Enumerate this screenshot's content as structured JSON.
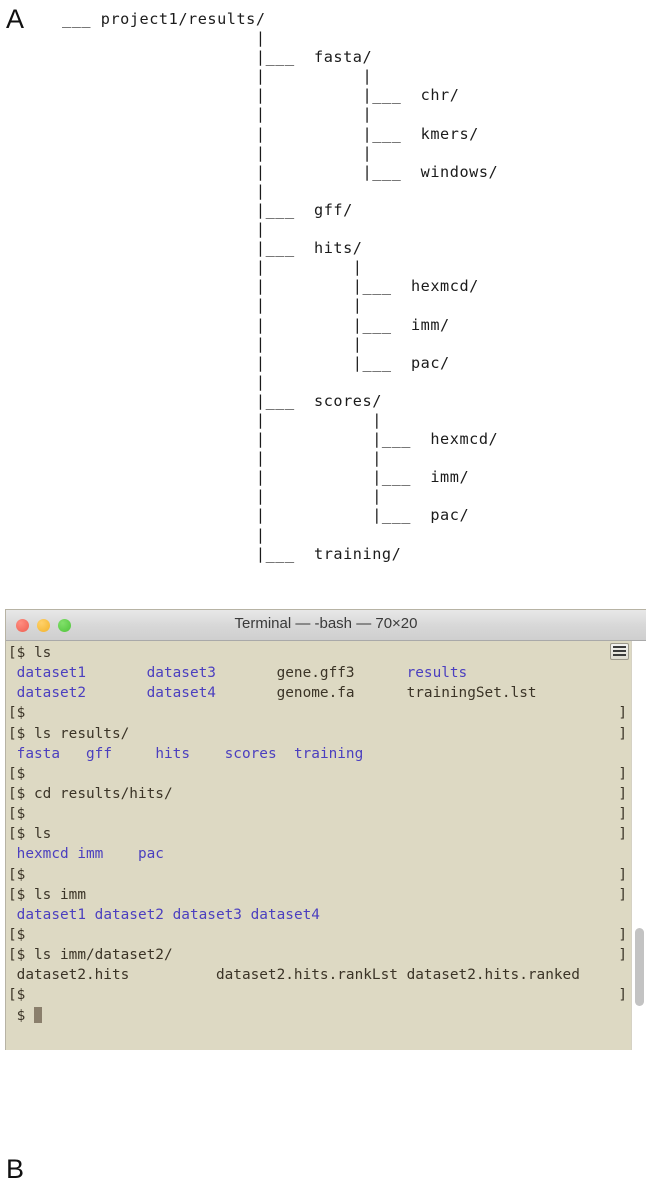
{
  "panels": {
    "a_label": "A",
    "b_label": "B"
  },
  "tree": {
    "root": "project1/results/",
    "ascii": "___ project1/results/\n                    |\n                    |___  fasta/\n                    |          |\n                    |          |___  chr/\n                    |          |\n                    |          |___  kmers/\n                    |          |\n                    |          |___  windows/\n                    |\n                    |___  gff/\n                    |\n                    |___  hits/\n                    |         |\n                    |         |___  hexmcd/\n                    |         |\n                    |         |___  imm/\n                    |         |\n                    |         |___  pac/\n                    |\n                    |___  scores/\n                    |           |\n                    |           |___  hexmcd/\n                    |           |\n                    |           |___  imm/\n                    |           |\n                    |           |___  pac/\n                    |\n                    |___  training/",
    "nodes": [
      "project1/results/",
      "fasta/",
      "chr/",
      "kmers/",
      "windows/",
      "gff/",
      "hits/",
      "hexmcd/",
      "imm/",
      "pac/",
      "scores/",
      "hexmcd/",
      "imm/",
      "pac/",
      "training/"
    ]
  },
  "terminal": {
    "title": "Terminal — -bash — 70×20",
    "prompt": "$",
    "prompt_left_bracket": "[",
    "prompt_right_bracket": "]",
    "colors": {
      "background": "#ddd9c3",
      "text": "#3b3427",
      "directory": "#4b3fbf",
      "cursor": "#8a7f6c",
      "titlebar": "#d8d8d8",
      "close_button": "#ee5f52",
      "minimize_button": "#f2b32b",
      "zoom_button": "#4fc43a"
    },
    "window_buttons": {
      "close": "close-button",
      "minimize": "minimize-button",
      "zoom": "zoom-button"
    },
    "lines_button_icon": "lines-icon",
    "lines": [
      {
        "kind": "prompt",
        "command": "ls",
        "bracket": true
      },
      {
        "kind": "output",
        "cells": [
          {
            "text": "dataset1",
            "type": "dir"
          },
          {
            "text": "dataset3",
            "type": "dir"
          },
          {
            "text": "gene.gff3",
            "type": "file"
          },
          {
            "text": "results",
            "type": "dir"
          }
        ],
        "raw": " dataset1       dataset3       gene.gff3      results"
      },
      {
        "kind": "output",
        "cells": [
          {
            "text": "dataset2",
            "type": "dir"
          },
          {
            "text": "dataset4",
            "type": "dir"
          },
          {
            "text": "genome.fa",
            "type": "file"
          },
          {
            "text": "trainingSet.lst",
            "type": "file"
          }
        ],
        "raw": " dataset2       dataset4       genome.fa      trainingSet.lst"
      },
      {
        "kind": "prompt",
        "command": "",
        "bracket": true
      },
      {
        "kind": "prompt",
        "command": "ls results/",
        "bracket": true
      },
      {
        "kind": "output",
        "cells": [
          {
            "text": "fasta",
            "type": "dir"
          },
          {
            "text": "gff",
            "type": "dir"
          },
          {
            "text": "hits",
            "type": "dir"
          },
          {
            "text": "scores",
            "type": "dir"
          },
          {
            "text": "training",
            "type": "dir"
          }
        ],
        "raw": " fasta   gff     hits    scores  training"
      },
      {
        "kind": "prompt",
        "command": "",
        "bracket": true
      },
      {
        "kind": "prompt",
        "command": "cd results/hits/",
        "bracket": true
      },
      {
        "kind": "prompt",
        "command": "",
        "bracket": true
      },
      {
        "kind": "prompt",
        "command": "ls",
        "bracket": true
      },
      {
        "kind": "output",
        "cells": [
          {
            "text": "hexmcd",
            "type": "dir"
          },
          {
            "text": "imm",
            "type": "dir"
          },
          {
            "text": "pac",
            "type": "dir"
          }
        ],
        "raw": " hexmcd imm    pac"
      },
      {
        "kind": "prompt",
        "command": "",
        "bracket": true
      },
      {
        "kind": "prompt",
        "command": "ls imm",
        "bracket": true
      },
      {
        "kind": "output",
        "cells": [
          {
            "text": "dataset1",
            "type": "dir"
          },
          {
            "text": "dataset2",
            "type": "dir"
          },
          {
            "text": "dataset3",
            "type": "dir"
          },
          {
            "text": "dataset4",
            "type": "dir"
          }
        ],
        "raw": " dataset1 dataset2 dataset3 dataset4"
      },
      {
        "kind": "prompt",
        "command": "",
        "bracket": true
      },
      {
        "kind": "prompt",
        "command": "ls imm/dataset2/",
        "bracket": true
      },
      {
        "kind": "output",
        "cells": [
          {
            "text": "dataset2.hits",
            "type": "file"
          },
          {
            "text": "dataset2.hits.rankLst",
            "type": "file"
          },
          {
            "text": "dataset2.hits.ranked",
            "type": "file"
          }
        ],
        "raw": " dataset2.hits          dataset2.hits.rankLst dataset2.hits.ranked"
      },
      {
        "kind": "prompt",
        "command": "",
        "bracket": true
      },
      {
        "kind": "cursor",
        "command": "",
        "bracket": false
      }
    ]
  }
}
